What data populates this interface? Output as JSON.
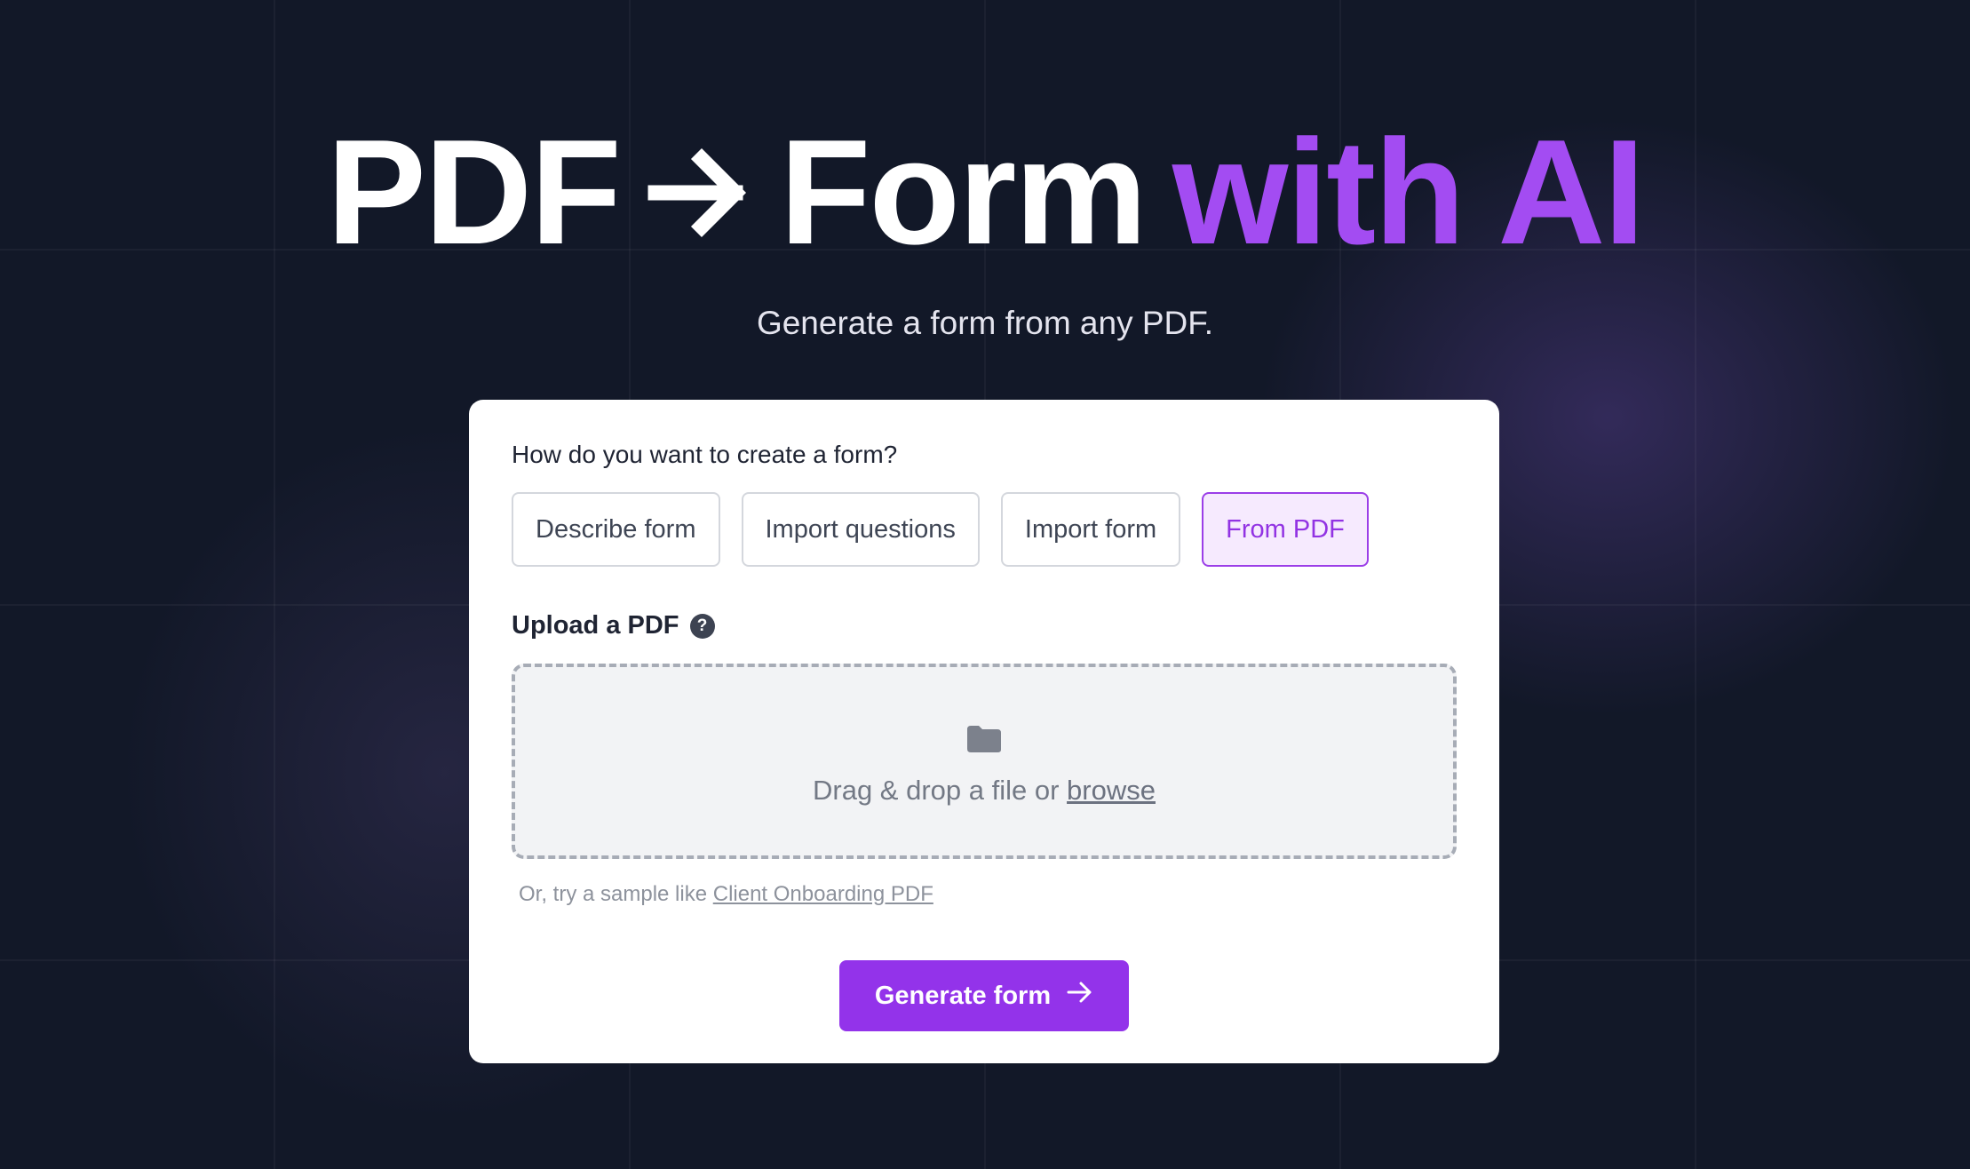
{
  "hero": {
    "title_part1": "PDF",
    "title_arrow_icon": "right-arrow-icon",
    "title_part2": "Form",
    "title_accent": "with AI",
    "subtitle": "Generate a form from any PDF."
  },
  "card": {
    "question": "How do you want to create a form?",
    "options": [
      {
        "label": "Describe form",
        "active": false
      },
      {
        "label": "Import questions",
        "active": false
      },
      {
        "label": "Import form",
        "active": false
      },
      {
        "label": "From PDF",
        "active": true
      }
    ],
    "upload_label": "Upload a PDF",
    "help_icon": "question-circle-icon",
    "help_glyph": "?",
    "dropzone": {
      "icon": "folder-icon",
      "text": "Drag & drop a file or",
      "browse": "browse"
    },
    "sample": {
      "prefix": "Or, try a sample like",
      "link": "Client Onboarding PDF"
    },
    "generate_button": "Generate form",
    "generate_icon": "right-arrow-icon"
  },
  "colors": {
    "background": "#121828",
    "accent": "#9333ea",
    "accent_text": "#a34cf2",
    "active_option_bg": "#f6eafe"
  }
}
